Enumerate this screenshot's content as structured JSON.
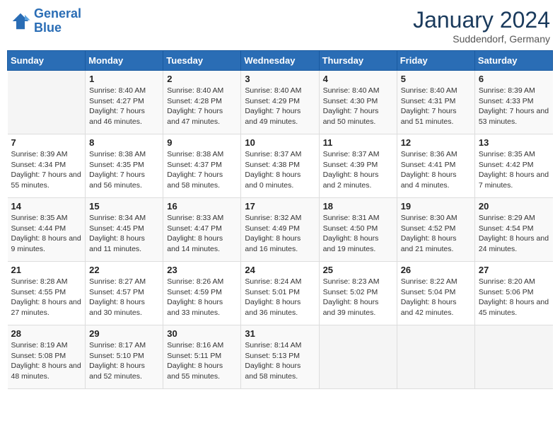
{
  "logo": {
    "line1": "General",
    "line2": "Blue"
  },
  "title": "January 2024",
  "subtitle": "Suddendorf, Germany",
  "days_header": [
    "Sunday",
    "Monday",
    "Tuesday",
    "Wednesday",
    "Thursday",
    "Friday",
    "Saturday"
  ],
  "weeks": [
    [
      {
        "num": "",
        "sunrise": "",
        "sunset": "",
        "daylight": ""
      },
      {
        "num": "1",
        "sunrise": "Sunrise: 8:40 AM",
        "sunset": "Sunset: 4:27 PM",
        "daylight": "Daylight: 7 hours and 46 minutes."
      },
      {
        "num": "2",
        "sunrise": "Sunrise: 8:40 AM",
        "sunset": "Sunset: 4:28 PM",
        "daylight": "Daylight: 7 hours and 47 minutes."
      },
      {
        "num": "3",
        "sunrise": "Sunrise: 8:40 AM",
        "sunset": "Sunset: 4:29 PM",
        "daylight": "Daylight: 7 hours and 49 minutes."
      },
      {
        "num": "4",
        "sunrise": "Sunrise: 8:40 AM",
        "sunset": "Sunset: 4:30 PM",
        "daylight": "Daylight: 7 hours and 50 minutes."
      },
      {
        "num": "5",
        "sunrise": "Sunrise: 8:40 AM",
        "sunset": "Sunset: 4:31 PM",
        "daylight": "Daylight: 7 hours and 51 minutes."
      },
      {
        "num": "6",
        "sunrise": "Sunrise: 8:39 AM",
        "sunset": "Sunset: 4:33 PM",
        "daylight": "Daylight: 7 hours and 53 minutes."
      }
    ],
    [
      {
        "num": "7",
        "sunrise": "Sunrise: 8:39 AM",
        "sunset": "Sunset: 4:34 PM",
        "daylight": "Daylight: 7 hours and 55 minutes."
      },
      {
        "num": "8",
        "sunrise": "Sunrise: 8:38 AM",
        "sunset": "Sunset: 4:35 PM",
        "daylight": "Daylight: 7 hours and 56 minutes."
      },
      {
        "num": "9",
        "sunrise": "Sunrise: 8:38 AM",
        "sunset": "Sunset: 4:37 PM",
        "daylight": "Daylight: 7 hours and 58 minutes."
      },
      {
        "num": "10",
        "sunrise": "Sunrise: 8:37 AM",
        "sunset": "Sunset: 4:38 PM",
        "daylight": "Daylight: 8 hours and 0 minutes."
      },
      {
        "num": "11",
        "sunrise": "Sunrise: 8:37 AM",
        "sunset": "Sunset: 4:39 PM",
        "daylight": "Daylight: 8 hours and 2 minutes."
      },
      {
        "num": "12",
        "sunrise": "Sunrise: 8:36 AM",
        "sunset": "Sunset: 4:41 PM",
        "daylight": "Daylight: 8 hours and 4 minutes."
      },
      {
        "num": "13",
        "sunrise": "Sunrise: 8:35 AM",
        "sunset": "Sunset: 4:42 PM",
        "daylight": "Daylight: 8 hours and 7 minutes."
      }
    ],
    [
      {
        "num": "14",
        "sunrise": "Sunrise: 8:35 AM",
        "sunset": "Sunset: 4:44 PM",
        "daylight": "Daylight: 8 hours and 9 minutes."
      },
      {
        "num": "15",
        "sunrise": "Sunrise: 8:34 AM",
        "sunset": "Sunset: 4:45 PM",
        "daylight": "Daylight: 8 hours and 11 minutes."
      },
      {
        "num": "16",
        "sunrise": "Sunrise: 8:33 AM",
        "sunset": "Sunset: 4:47 PM",
        "daylight": "Daylight: 8 hours and 14 minutes."
      },
      {
        "num": "17",
        "sunrise": "Sunrise: 8:32 AM",
        "sunset": "Sunset: 4:49 PM",
        "daylight": "Daylight: 8 hours and 16 minutes."
      },
      {
        "num": "18",
        "sunrise": "Sunrise: 8:31 AM",
        "sunset": "Sunset: 4:50 PM",
        "daylight": "Daylight: 8 hours and 19 minutes."
      },
      {
        "num": "19",
        "sunrise": "Sunrise: 8:30 AM",
        "sunset": "Sunset: 4:52 PM",
        "daylight": "Daylight: 8 hours and 21 minutes."
      },
      {
        "num": "20",
        "sunrise": "Sunrise: 8:29 AM",
        "sunset": "Sunset: 4:54 PM",
        "daylight": "Daylight: 8 hours and 24 minutes."
      }
    ],
    [
      {
        "num": "21",
        "sunrise": "Sunrise: 8:28 AM",
        "sunset": "Sunset: 4:55 PM",
        "daylight": "Daylight: 8 hours and 27 minutes."
      },
      {
        "num": "22",
        "sunrise": "Sunrise: 8:27 AM",
        "sunset": "Sunset: 4:57 PM",
        "daylight": "Daylight: 8 hours and 30 minutes."
      },
      {
        "num": "23",
        "sunrise": "Sunrise: 8:26 AM",
        "sunset": "Sunset: 4:59 PM",
        "daylight": "Daylight: 8 hours and 33 minutes."
      },
      {
        "num": "24",
        "sunrise": "Sunrise: 8:24 AM",
        "sunset": "Sunset: 5:01 PM",
        "daylight": "Daylight: 8 hours and 36 minutes."
      },
      {
        "num": "25",
        "sunrise": "Sunrise: 8:23 AM",
        "sunset": "Sunset: 5:02 PM",
        "daylight": "Daylight: 8 hours and 39 minutes."
      },
      {
        "num": "26",
        "sunrise": "Sunrise: 8:22 AM",
        "sunset": "Sunset: 5:04 PM",
        "daylight": "Daylight: 8 hours and 42 minutes."
      },
      {
        "num": "27",
        "sunrise": "Sunrise: 8:20 AM",
        "sunset": "Sunset: 5:06 PM",
        "daylight": "Daylight: 8 hours and 45 minutes."
      }
    ],
    [
      {
        "num": "28",
        "sunrise": "Sunrise: 8:19 AM",
        "sunset": "Sunset: 5:08 PM",
        "daylight": "Daylight: 8 hours and 48 minutes."
      },
      {
        "num": "29",
        "sunrise": "Sunrise: 8:17 AM",
        "sunset": "Sunset: 5:10 PM",
        "daylight": "Daylight: 8 hours and 52 minutes."
      },
      {
        "num": "30",
        "sunrise": "Sunrise: 8:16 AM",
        "sunset": "Sunset: 5:11 PM",
        "daylight": "Daylight: 8 hours and 55 minutes."
      },
      {
        "num": "31",
        "sunrise": "Sunrise: 8:14 AM",
        "sunset": "Sunset: 5:13 PM",
        "daylight": "Daylight: 8 hours and 58 minutes."
      },
      {
        "num": "",
        "sunrise": "",
        "sunset": "",
        "daylight": ""
      },
      {
        "num": "",
        "sunrise": "",
        "sunset": "",
        "daylight": ""
      },
      {
        "num": "",
        "sunrise": "",
        "sunset": "",
        "daylight": ""
      }
    ]
  ]
}
